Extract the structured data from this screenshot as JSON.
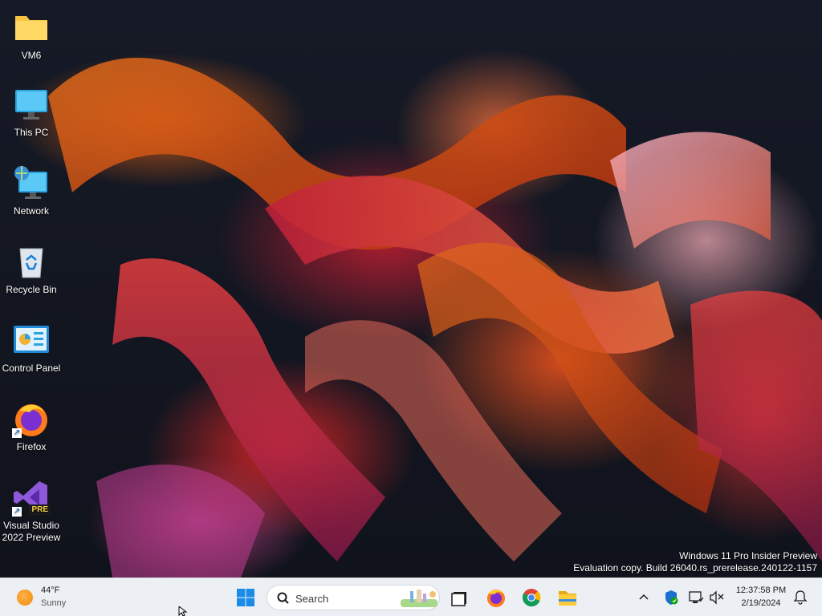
{
  "desktop": {
    "icons": [
      {
        "label": "VM6",
        "icon": "folder-icon"
      },
      {
        "label": "This PC",
        "icon": "monitor-icon"
      },
      {
        "label": "Network",
        "icon": "network-icon"
      },
      {
        "label": "Recycle Bin",
        "icon": "recycle-bin-icon"
      },
      {
        "label": "Control Panel",
        "icon": "control-panel-icon"
      },
      {
        "label": "Firefox",
        "icon": "firefox-icon"
      },
      {
        "label": "Visual Studio 2022 Preview",
        "icon": "visual-studio-icon",
        "badge": "PRE"
      }
    ],
    "watermark": {
      "line1": "Windows 11 Pro Insider Preview",
      "line2": "Evaluation copy. Build 26040.rs_prerelease.240122-1157"
    }
  },
  "taskbar": {
    "weather": {
      "temp": "44°F",
      "condition": "Sunny",
      "icon": "sun-icon"
    },
    "search": {
      "placeholder": "Search"
    },
    "pinned": [
      {
        "name": "start-button",
        "icon": "windows-logo-icon"
      },
      {
        "name": "task-view-button",
        "icon": "task-view-icon"
      },
      {
        "name": "firefox-taskbar-button",
        "icon": "firefox-icon"
      },
      {
        "name": "chrome-taskbar-button",
        "icon": "chrome-icon"
      },
      {
        "name": "file-explorer-taskbar-button",
        "icon": "folder-icon"
      }
    ],
    "clock": {
      "time": "12:37:58 PM",
      "date": "2/19/2024"
    },
    "tray": [
      "chevron-up-icon",
      "security-shield-icon",
      "network-status-icon",
      "volume-muted-icon",
      "notification-bell-icon"
    ]
  },
  "colors": {
    "taskbar_bg": "#eceff3",
    "accent_blue": "#0a66c2",
    "wallpaper_dark": "#141620"
  }
}
